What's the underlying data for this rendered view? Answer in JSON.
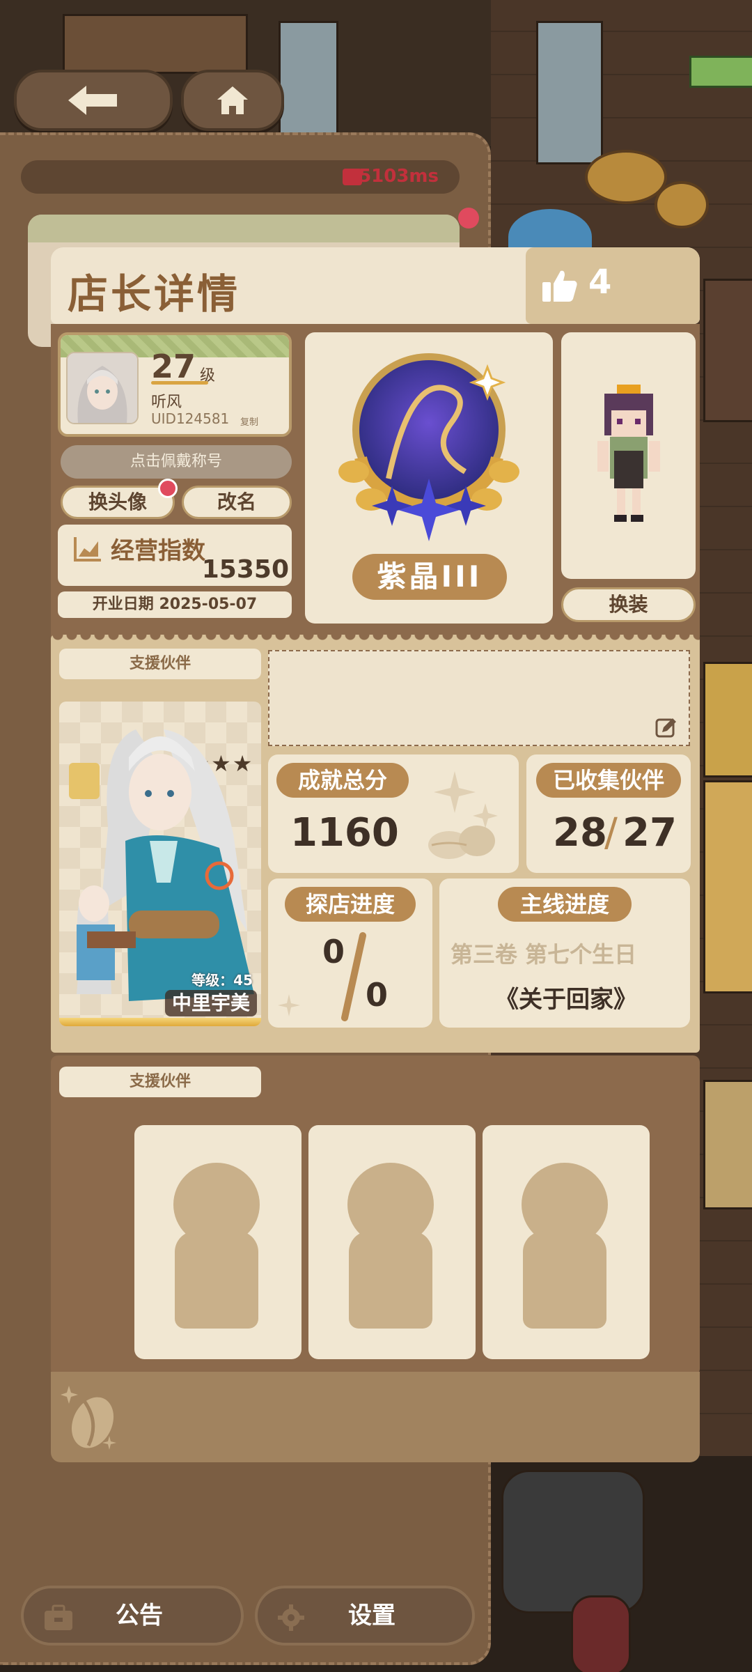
{
  "network": {
    "ping": "5103ms"
  },
  "header": {
    "title": "店长详情",
    "likes": "4"
  },
  "profile": {
    "level": "27",
    "level_unit": "级",
    "name": "听风",
    "uid": "UID124581",
    "copy_label": "复制",
    "title_button": "点击佩戴称号",
    "change_avatar_button": "换头像",
    "rename_button": "改名"
  },
  "business": {
    "label": "经营指数",
    "value": "15350",
    "open_date": "开业日期 2025-05-07"
  },
  "rank": {
    "name": "紫晶III"
  },
  "outfit_button": "换装",
  "support": {
    "label": "支援伙伴",
    "partner": {
      "stars": "★★★★★",
      "level": "等级：45",
      "name": "中里宇美"
    }
  },
  "stats": {
    "achievement_label": "成就总分",
    "achievement_value": "1160",
    "partners_label": "已收集伙伴",
    "partners_value": "28",
    "partners_total": "27",
    "partners_sep": "/",
    "visit_label": "探店进度",
    "visit_top": "0",
    "visit_bottom": "0",
    "story_label": "主线进度",
    "story_chapter": "第三卷 第七个生日",
    "story_title": "《关于回家》"
  },
  "support2": {
    "label": "支援伙伴"
  },
  "bottom": {
    "notice": "公告",
    "settings": "设置"
  },
  "colors": {
    "accent": "#b88a52",
    "panel": "#f1e7d2",
    "frame": "#7b5e43",
    "alert": "#c2303c"
  }
}
